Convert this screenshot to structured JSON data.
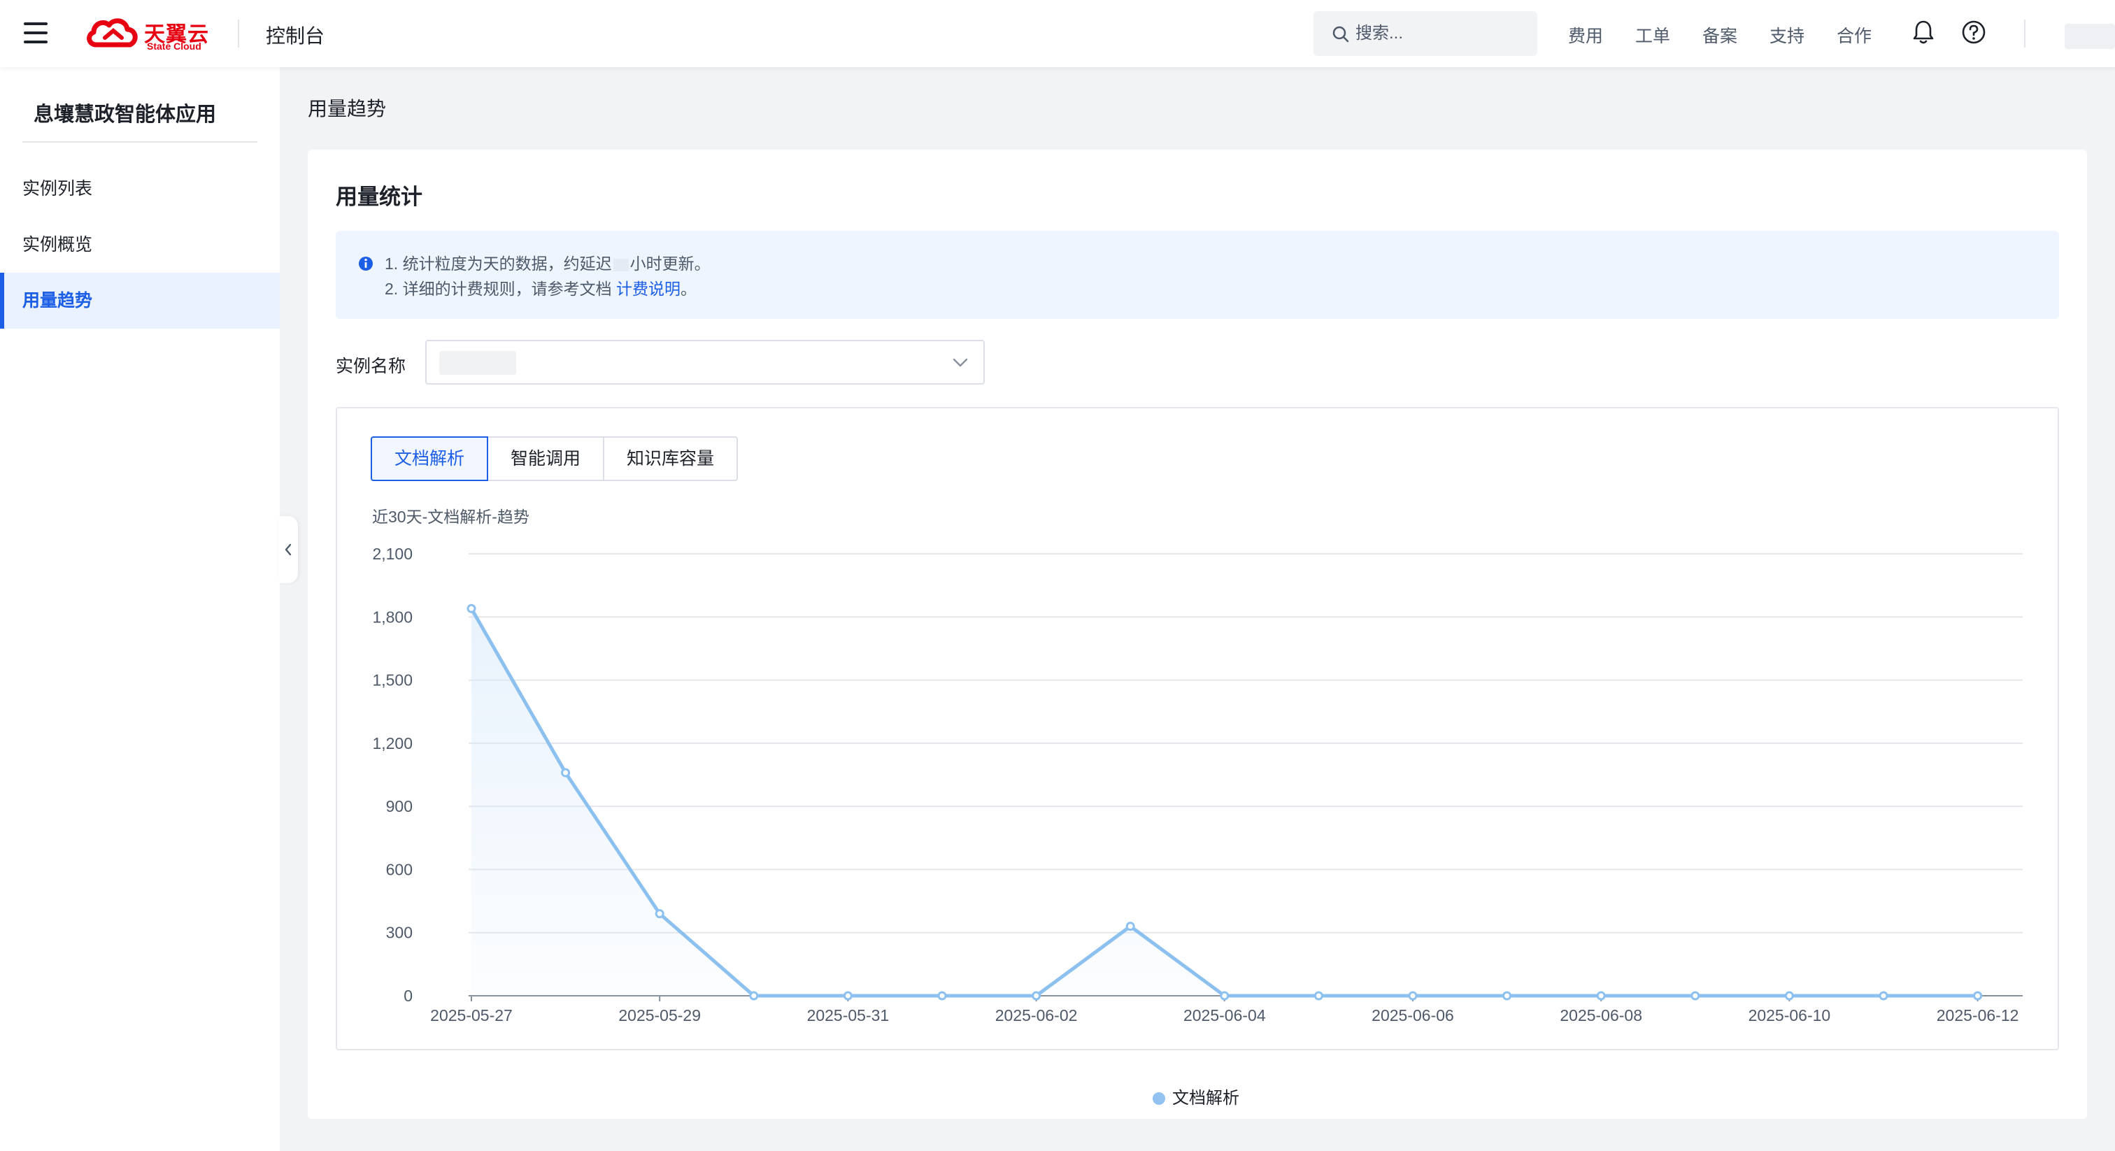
{
  "header": {
    "logo_text": "天翼云",
    "logo_subtext": "State Cloud",
    "console_title": "控制台",
    "search_placeholder": "搜索...",
    "nav": [
      "费用",
      "工单",
      "备案",
      "支持",
      "合作"
    ]
  },
  "sidebar": {
    "app_title": "息壤慧政智能体应用",
    "items": [
      {
        "label": "实例列表",
        "active": false
      },
      {
        "label": "实例概览",
        "active": false
      },
      {
        "label": "用量趋势",
        "active": true
      }
    ]
  },
  "main": {
    "breadcrumb": "用量趋势",
    "card_title": "用量统计",
    "notice": {
      "line1_prefix": "1. 统计粒度为天的数据，约延迟",
      "line1_suffix": "小时更新。",
      "line2_prefix": "2. 详细的计费规则，请参考文档",
      "line2_link": "计费说明",
      "line2_suffix": "。"
    },
    "instance_label": "实例名称",
    "tabs": [
      {
        "label": "文档解析",
        "active": true
      },
      {
        "label": "智能调用",
        "active": false
      },
      {
        "label": "知识库容量",
        "active": false
      }
    ]
  },
  "colors": {
    "accent": "#1c5fe6",
    "series_line": "#8cc0ee",
    "brand_red": "#e60012"
  },
  "chart_data": {
    "type": "line",
    "title": "近30天-文档解析-趋势",
    "x": [
      "2025-05-27",
      "2025-05-28",
      "2025-05-29",
      "2025-05-30",
      "2025-05-31",
      "2025-06-01",
      "2025-06-02",
      "2025-06-03",
      "2025-06-04",
      "2025-06-05",
      "2025-06-06",
      "2025-06-07",
      "2025-06-08",
      "2025-06-09",
      "2025-06-10",
      "2025-06-11",
      "2025-06-12"
    ],
    "x_tick_labels": [
      "2025-05-27",
      "2025-05-29",
      "2025-05-31",
      "2025-06-02",
      "2025-06-04",
      "2025-06-06",
      "2025-06-08",
      "2025-06-10",
      "2025-06-12"
    ],
    "y_ticks": [
      "2,100",
      "1,800",
      "1,500",
      "1,200",
      "900",
      "600",
      "300",
      "0"
    ],
    "ylim": [
      0,
      2100
    ],
    "series": [
      {
        "name": "文档解析",
        "values": [
          1840,
          1060,
          390,
          0,
          0,
          0,
          0,
          330,
          0,
          0,
          0,
          0,
          0,
          0,
          0,
          0,
          0
        ]
      }
    ],
    "legend": "bottom-center",
    "grid": true
  }
}
